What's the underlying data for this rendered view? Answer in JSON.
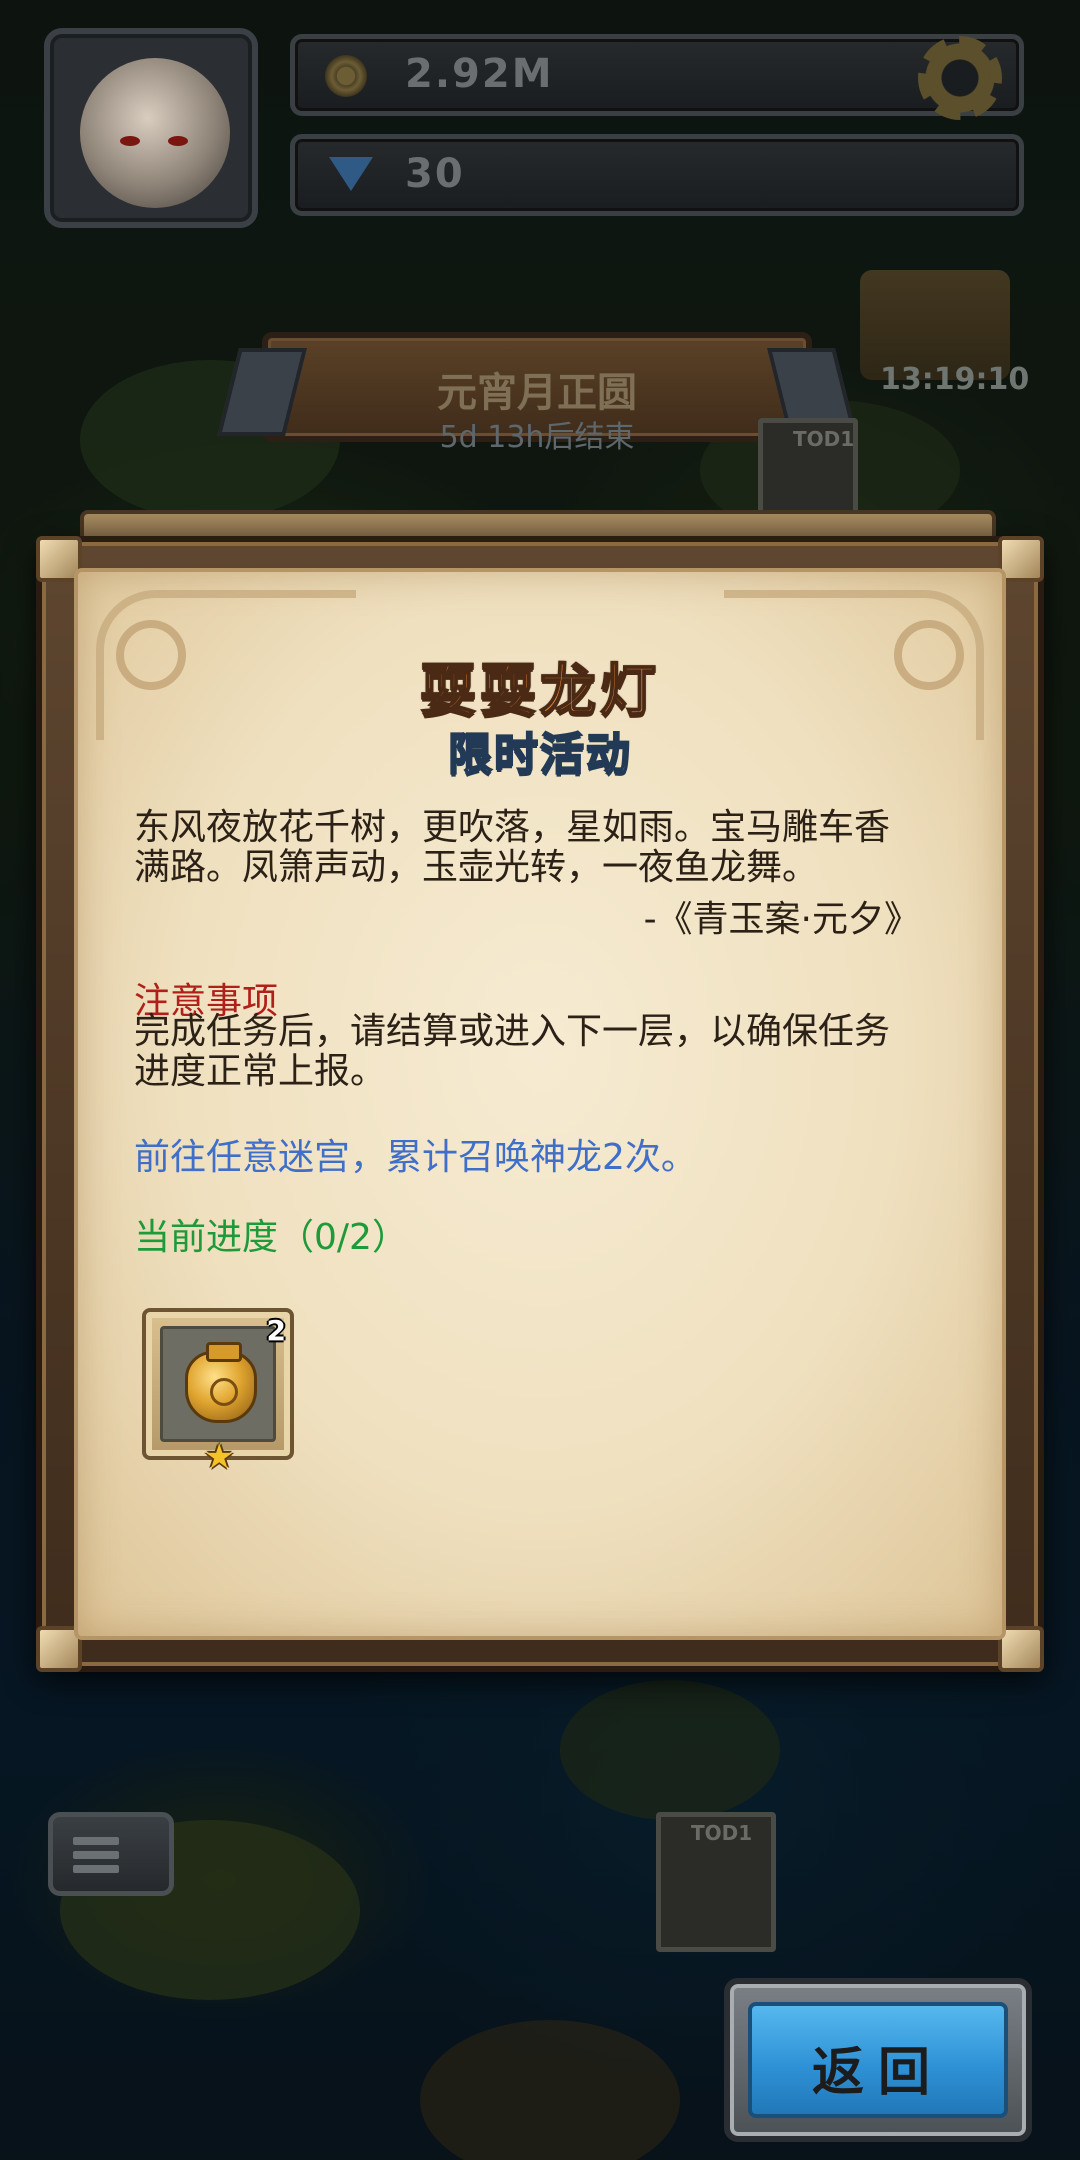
{
  "hud": {
    "coins": "2.92M",
    "gems": "30",
    "timer": "13:19:10"
  },
  "event_banner": {
    "title": "元宵月正圆",
    "countdown": "5d 13h后结束"
  },
  "map_badges": [
    "TOD1",
    "TOD1"
  ],
  "dialog": {
    "title": "耍耍龙灯",
    "subtitle": "限时活动",
    "poem": "东风夜放花千树，更吹落，星如雨。宝马雕车香满路。凤箫声动，玉壶光转，一夜鱼龙舞。",
    "poem_source": "-《青玉案·元夕》",
    "notice_label": "注意事项",
    "notice_body": "完成任务后，请结算或进入下一层，以确保任务进度正常上报。",
    "task_description": "前往任意迷宫，累计召唤神龙2次。",
    "progress_label": "当前进度（0/2）",
    "reward": {
      "icon": "golden-urn-icon",
      "count": "2",
      "star": "★"
    }
  },
  "buttons": {
    "back": "返回"
  },
  "colors": {
    "title_orange": "#f2883a",
    "subtitle_blue": "#a9d6ec",
    "notice_red": "#b0201a",
    "task_blue": "#3f6fc8",
    "progress_green": "#1f9a3a",
    "back_button_blue": "#2f92d6"
  }
}
